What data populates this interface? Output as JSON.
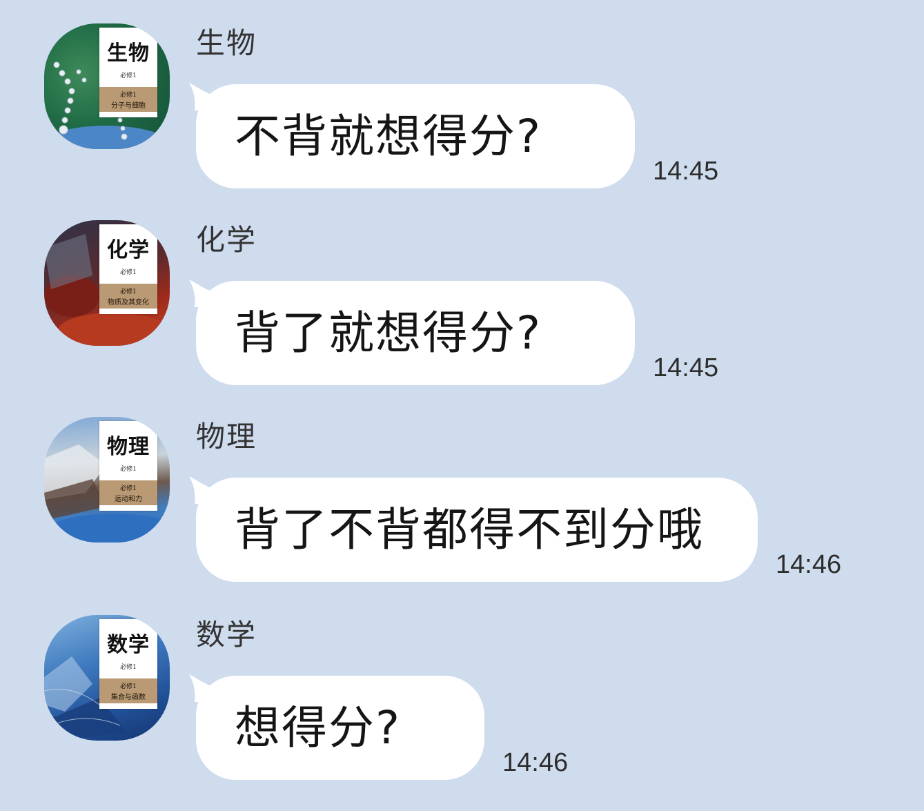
{
  "messages": [
    {
      "sender": "生物",
      "text": "不背就想得分?",
      "time": "14:45",
      "avatar": {
        "title": "生物",
        "volume": "必修1",
        "band_volume": "必修1",
        "subtitle": "分子与细胞",
        "icon": "biology-textbook-cover"
      }
    },
    {
      "sender": "化学",
      "text": "背了就想得分?",
      "time": "14:45",
      "avatar": {
        "title": "化学",
        "volume": "必修1",
        "band_volume": "必修1",
        "subtitle": "物质及其变化",
        "icon": "chemistry-textbook-cover"
      }
    },
    {
      "sender": "物理",
      "text": "背了不背都得不到分哦",
      "time": "14:46",
      "avatar": {
        "title": "物理",
        "volume": "必修1",
        "band_volume": "必修1",
        "subtitle": "运动和力",
        "icon": "physics-textbook-cover"
      }
    },
    {
      "sender": "数学",
      "text": "想得分?",
      "time": "14:46",
      "avatar": {
        "title": "数学",
        "volume": "必修1",
        "band_volume": "必修1",
        "subtitle": "集合与函数",
        "icon": "math-textbook-cover"
      }
    }
  ],
  "colors": {
    "background": "#cfdcee",
    "bubble": "#ffffff",
    "message_text": "#151515",
    "name_text": "#333333",
    "book_band": "#b99a74"
  }
}
